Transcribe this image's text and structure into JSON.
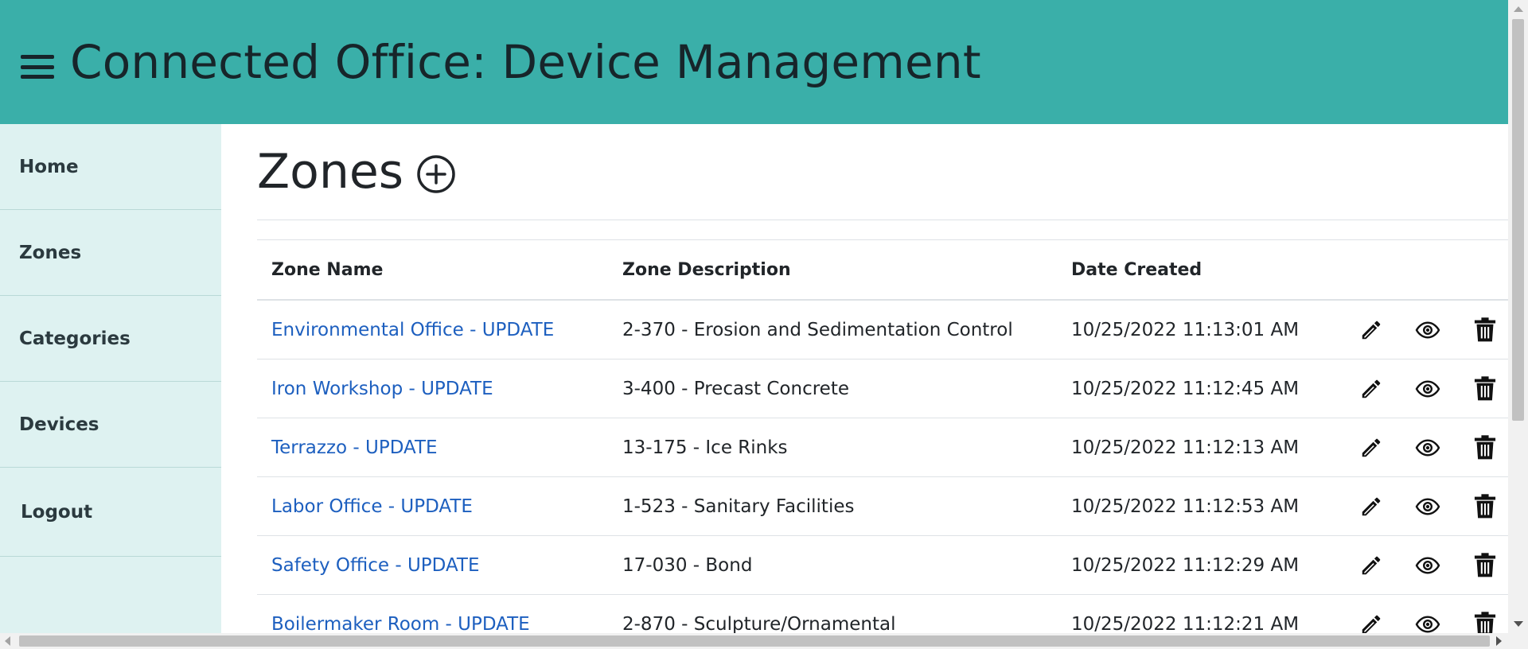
{
  "header": {
    "title": "Connected Office: Device Management",
    "menu_icon": "hamburger-menu-icon",
    "background_color": "#3aafa9",
    "text_color": "#17252a"
  },
  "sidebar": {
    "background_color": "#def2f1",
    "items": [
      {
        "label": "Home"
      },
      {
        "label": "Zones"
      },
      {
        "label": "Categories"
      },
      {
        "label": "Devices"
      },
      {
        "label": "Logout"
      }
    ]
  },
  "main": {
    "title": "Zones",
    "add_icon": "plus-circle-icon",
    "link_color": "#1d5fbf",
    "table": {
      "columns": [
        "Zone Name",
        "Zone Description",
        "Date Created"
      ],
      "action_icons": [
        "pencil-edit-icon",
        "eye-view-icon",
        "trash-delete-icon"
      ],
      "rows": [
        {
          "name": "Environmental Office - UPDATE",
          "description": "2-370 - Erosion and Sedimentation Control",
          "created": "10/25/2022 11:13:01 AM"
        },
        {
          "name": "Iron Workshop - UPDATE",
          "description": "3-400 - Precast Concrete",
          "created": "10/25/2022 11:12:45 AM"
        },
        {
          "name": "Terrazzo - UPDATE",
          "description": "13-175 - Ice Rinks",
          "created": "10/25/2022 11:12:13 AM"
        },
        {
          "name": "Labor Office - UPDATE",
          "description": "1-523 - Sanitary Facilities",
          "created": "10/25/2022 11:12:53 AM"
        },
        {
          "name": "Safety Office - UPDATE",
          "description": "17-030 - Bond",
          "created": "10/25/2022 11:12:29 AM"
        },
        {
          "name": "Boilermaker Room - UPDATE",
          "description": "2-870 - Sculpture/Ornamental",
          "created": "10/25/2022 11:12:21 AM"
        }
      ]
    }
  }
}
